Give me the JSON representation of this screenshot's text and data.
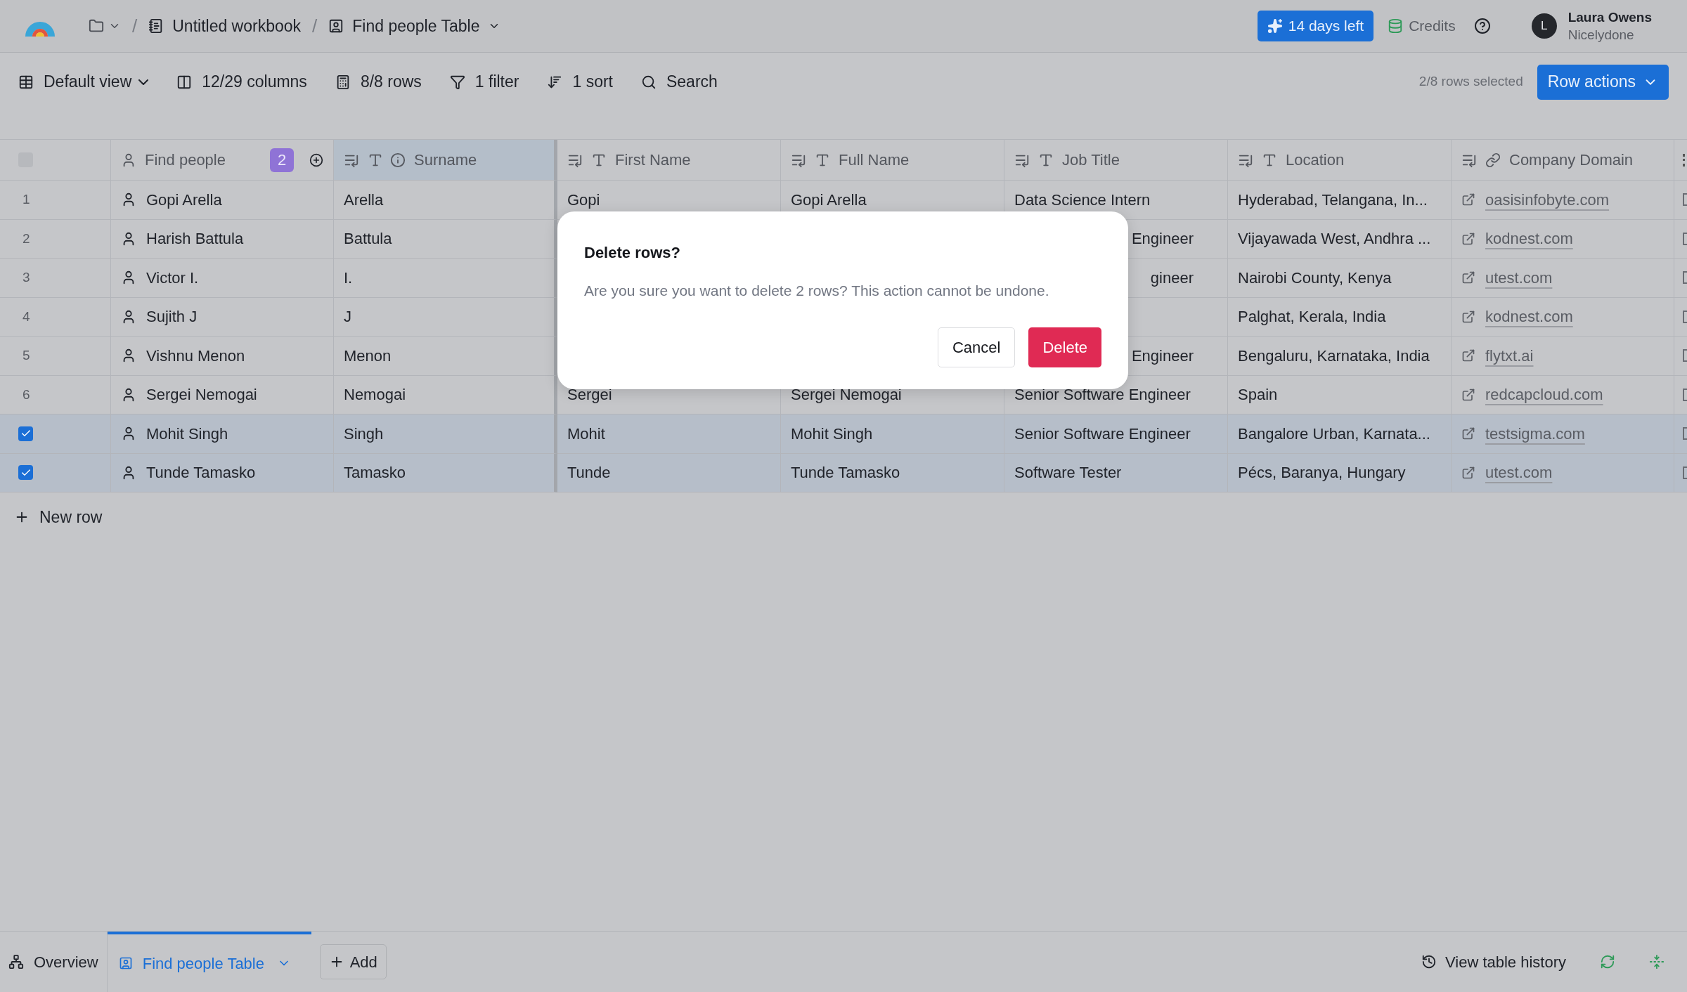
{
  "breadcrumb": {
    "separator_1": "/",
    "workbook": "Untitled workbook",
    "separator_2": "/",
    "table": "Find people Table"
  },
  "header_right": {
    "trial": "14 days left",
    "credits": "Credits",
    "user": {
      "initial": "L",
      "name": "Laura Owens",
      "org": "Nicelydone"
    }
  },
  "toolbar": {
    "items": [
      {
        "kind": "view",
        "label": "Default view"
      },
      {
        "kind": "columns",
        "label": "12/29 columns"
      },
      {
        "kind": "rows",
        "label": "8/8 rows"
      },
      {
        "kind": "filter",
        "label": "1 filter"
      },
      {
        "kind": "sort",
        "label": "1 sort"
      },
      {
        "kind": "search",
        "label": "Search"
      }
    ],
    "selection": "2/8 rows selected",
    "action": "Row actions"
  },
  "table": {
    "all_checked": false,
    "columns": [
      {
        "kind": "person",
        "label": "Find people",
        "badge": "2",
        "selected": false
      },
      {
        "kind": "text",
        "label": "Surname",
        "info": true,
        "selected": true
      },
      {
        "kind": "text",
        "label": "First Name",
        "selected": false
      },
      {
        "kind": "text",
        "label": "Full Name",
        "selected": false
      },
      {
        "kind": "text",
        "label": "Job Title",
        "selected": false
      },
      {
        "kind": "text",
        "label": "Location",
        "selected": false
      },
      {
        "kind": "link",
        "label": "Company Domain",
        "selected": false
      }
    ],
    "rows": [
      {
        "num": "1",
        "checked": false,
        "name": "Gopi Arella",
        "surname": "Arella",
        "first_name": "Gopi",
        "full_name": "Gopi Arella",
        "job_title": "Data Science Intern",
        "location": "Hyderabad, Telangana, In...",
        "domain": "oasisinfobyte.com"
      },
      {
        "num": "2",
        "checked": false,
        "name": "Harish Battula",
        "surname": "Battula",
        "job_title": "Engineer",
        "job_title_clipped": true,
        "location": "Vijayawada West, Andhra ...",
        "domain": "kodnest.com"
      },
      {
        "num": "3",
        "checked": false,
        "name": "Victor I.",
        "surname": "I.",
        "job_title": "gineer",
        "job_title_clipped": true,
        "location": "Nairobi County, Kenya",
        "domain": "utest.com"
      },
      {
        "num": "4",
        "checked": false,
        "name": "Sujith J",
        "surname": "J",
        "location": "Palghat, Kerala, India",
        "domain": "kodnest.com"
      },
      {
        "num": "5",
        "checked": false,
        "name": "Vishnu Menon",
        "surname": "Menon",
        "job_title": "Engineer",
        "job_title_clipped": true,
        "location": "Bengaluru, Karnataka, India",
        "domain": "flytxt.ai"
      },
      {
        "num": "6",
        "checked": false,
        "name": "Sergei Nemogai",
        "surname": "Nemogai",
        "first_name": "Sergei",
        "full_name": "Sergei Nemogai",
        "job_title": "Senior Software Engineer",
        "location": "Spain",
        "domain": "redcapcloud.com"
      },
      {
        "checked": true,
        "name": "Mohit Singh",
        "surname": "Singh",
        "first_name": "Mohit",
        "full_name": "Mohit Singh",
        "job_title": "Senior Software Engineer",
        "location": "Bangalore Urban, Karnata...",
        "domain": "testsigma.com"
      },
      {
        "checked": true,
        "name": "Tunde Tamasko",
        "surname": "Tamasko",
        "first_name": "Tunde",
        "full_name": "Tunde Tamasko",
        "job_title": "Software Tester",
        "location": "Pécs, Baranya, Hungary",
        "domain": "utest.com"
      }
    ],
    "new_row": "New row"
  },
  "dialog": {
    "title": "Delete rows?",
    "message": "Are you sure you want to delete 2 rows? This action cannot be undone.",
    "cancel": "Cancel",
    "confirm": "Delete"
  },
  "bottom_bar": {
    "overview": "Overview",
    "tabs": [
      {
        "label": "Find people Table",
        "selected": true
      }
    ],
    "add": "Add",
    "history": "View table history"
  }
}
